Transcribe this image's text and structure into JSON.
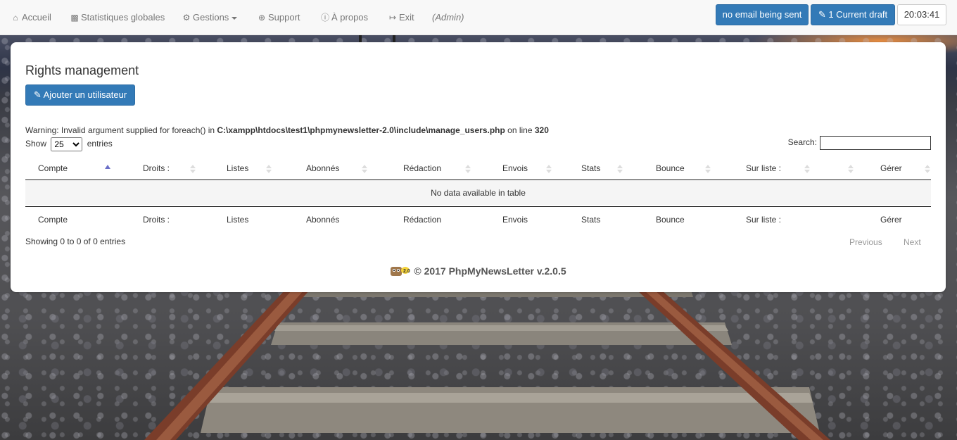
{
  "nav": {
    "home": "Accueil",
    "stats": "Statistiques globales",
    "gestions": "Gestions",
    "support": "Support",
    "about": "À propos",
    "exit": "Exit",
    "admin": "(Admin)",
    "no_email": "no email being sent",
    "draft": "1 Current draft",
    "clock": "20:03:41"
  },
  "panel": {
    "title": "Rights management",
    "add_user": "Ajouter un utilisateur",
    "warning_prefix": "Warning",
    "warning_text": ": Invalid argument supplied for foreach() in ",
    "warning_path": "C:\\xampp\\htdocs\\test1\\phpmynewsletter-2.0\\include\\manage_users.php",
    "warning_suffix": " on line ",
    "warning_line": "320",
    "show_label": "Show",
    "show_value": "25",
    "entries_label": "entries",
    "search_label": "Search:",
    "columns": [
      "Compte",
      "Droits :",
      "Listes",
      "Abonnés",
      "Rédaction",
      "Envois",
      "Stats",
      "Bounce",
      "Sur liste :",
      "",
      "Gérer"
    ],
    "empty": "No data available in table",
    "info": "Showing 0 to 0 of 0 entries",
    "previous": "Previous",
    "next": "Next",
    "footer": "© 2017 PhpMyNewsLetter v.2.0.5"
  },
  "colors": {
    "primary": "#337ab7",
    "sort_active": "#6b6fc8"
  }
}
